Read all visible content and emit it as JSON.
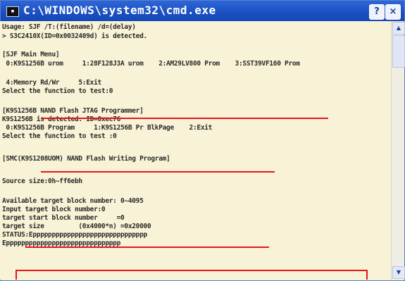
{
  "window": {
    "title": "C:\\WINDOWS\\system32\\cmd.exe",
    "icon": "console-icon",
    "controls": {
      "help": "?",
      "close": "×"
    }
  },
  "console": {
    "lines": [
      "Usage: SJF /T:(filename) /d=(delay)",
      "> S3C2410X(ID=0x0032409d) is detected.",
      "",
      "[SJF Main Menu]",
      " 0:K9S1256B urom     1:28F128J3A urom    2:AM29LV800 Prom    3:SST39VF160 Prom",
      "",
      " 4:Memory Rd/Wr     5:Exit",
      "Select the function to test:0",
      "",
      "[K9S1256B NAND Flash JTAG Programmer]",
      "K9S1256B is detected. ID=0xec76",
      " 0:K9S1256B Program     1:K9S1256B Pr BlkPage    2:Exit",
      "Select the function to test :0",
      "",
      "[SMC(K9S1208UOM) NAND Flash Writing Program]",
      "",
      "Source size:0h~ff6ebh",
      "",
      "Available target block number: 0~4095",
      "Input target block number:0",
      "target start block number     =0",
      "target size         (0x4000*n) =0x20000",
      "STATUS:Epppppppppppppppppppppppppppppp",
      "Epppppppppppppppppppppppppppppp"
    ]
  },
  "colors": {
    "titlebar": "#1a4fc0",
    "console_bg": "#f8f3d6",
    "text": "#2a2a2a",
    "annotation": "#e8141c"
  }
}
